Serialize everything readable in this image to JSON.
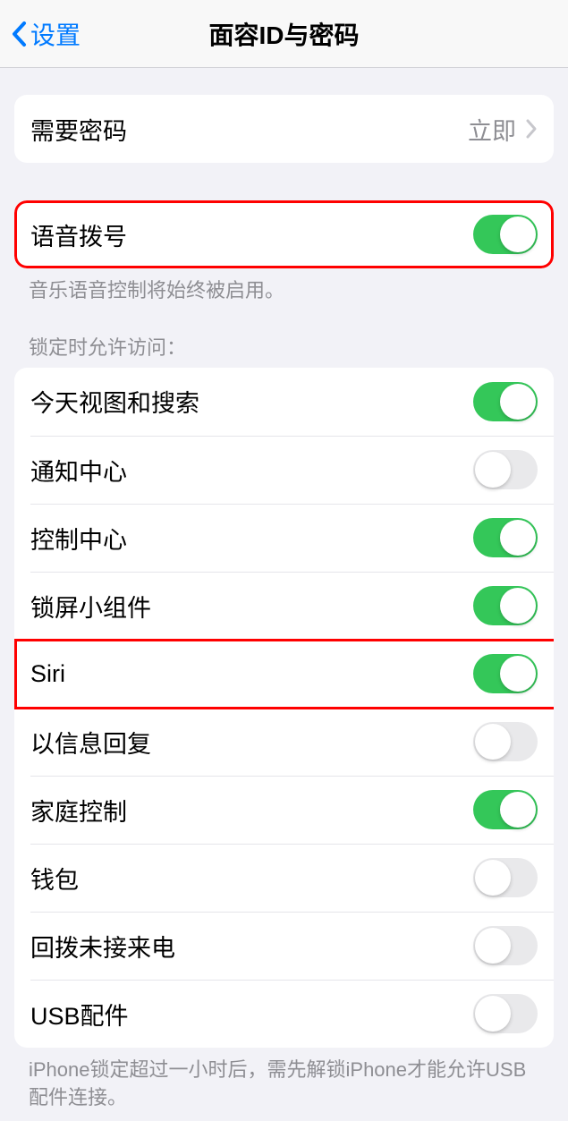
{
  "header": {
    "back_label": "设置",
    "title": "面容ID与密码"
  },
  "passcode_group": {
    "require_passcode": {
      "label": "需要密码",
      "value": "立即"
    }
  },
  "voice_dial_group": {
    "voice_dial": {
      "label": "语音拨号",
      "on": true
    },
    "footnote": "音乐语音控制将始终被启用。"
  },
  "allow_when_locked": {
    "header": "锁定时允许访问：",
    "items": [
      {
        "key": "today",
        "label": "今天视图和搜索",
        "on": true
      },
      {
        "key": "notification",
        "label": "通知中心",
        "on": false
      },
      {
        "key": "control",
        "label": "控制中心",
        "on": true
      },
      {
        "key": "widget",
        "label": "锁屏小组件",
        "on": true
      },
      {
        "key": "siri",
        "label": "Siri",
        "on": true
      },
      {
        "key": "msgreply",
        "label": "以信息回复",
        "on": false
      },
      {
        "key": "home",
        "label": "家庭控制",
        "on": true
      },
      {
        "key": "wallet",
        "label": "钱包",
        "on": false
      },
      {
        "key": "callback",
        "label": "回拨未接来电",
        "on": false
      },
      {
        "key": "usb",
        "label": "USB配件",
        "on": false
      }
    ],
    "footnote": "iPhone锁定超过一小时后，需先解锁iPhone才能允许USB配件连接。"
  }
}
